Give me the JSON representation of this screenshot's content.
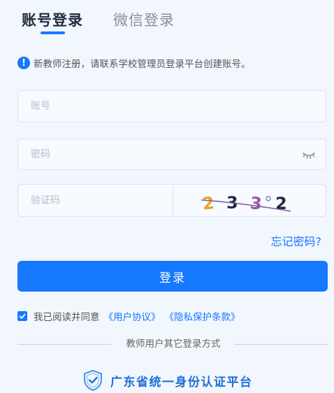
{
  "tabs": [
    {
      "label": "账号登录",
      "active": true
    },
    {
      "label": "微信登录",
      "active": false
    }
  ],
  "notice": {
    "icon": "exclamation-icon",
    "text": "新教师注册，请联系学校管理员登录平台创建账号。"
  },
  "form": {
    "account_placeholder": "账号",
    "password_placeholder": "密码",
    "captcha_placeholder": "验证码",
    "captcha_text": "2 3 3 2"
  },
  "forgot_password": "忘记密码?",
  "login_button": "登录",
  "agreement": {
    "checked": true,
    "prefix": "我已阅读并同意",
    "user_agreement": "《用户协议》",
    "privacy_policy": "《隐私保护条款》"
  },
  "other_login": "教师用户其它登录方式",
  "platform_login": "广东省统一身份认证平台",
  "colors": {
    "accent": "#1677ff",
    "background": "#f2f7fd",
    "platform_text": "#1f6fd6"
  }
}
